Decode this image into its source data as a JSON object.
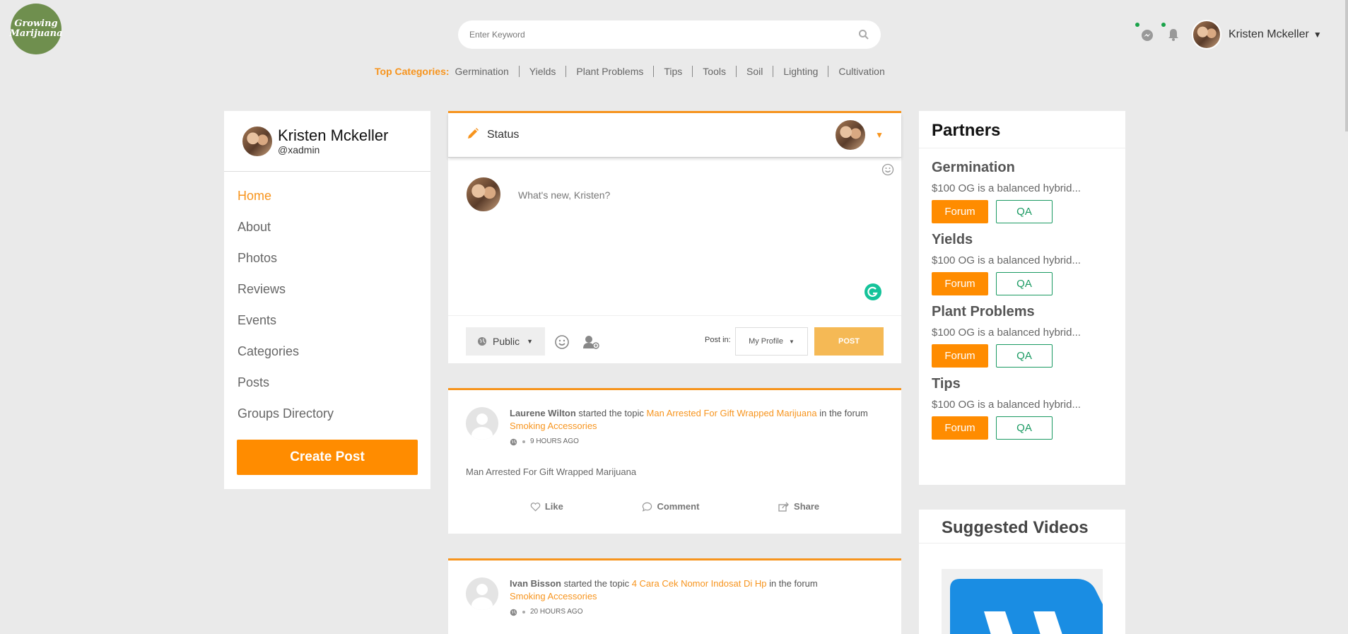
{
  "header": {
    "logo_line1": "Growing",
    "logo_line2": "Marijuana",
    "search_placeholder": "Enter Keyword",
    "top_categories_label": "Top Categories:",
    "top_categories": [
      "Germination",
      "Yields",
      "Plant Problems",
      "Tips",
      "Tools",
      "Soil",
      "Lighting",
      "Cultivation"
    ],
    "user_name": "Kristen Mckeller"
  },
  "profile": {
    "name": "Kristen Mckeller",
    "handle": "@xadmin"
  },
  "nav": {
    "items": [
      "Home",
      "About",
      "Photos",
      "Reviews",
      "Events",
      "Categories",
      "Posts",
      "Groups Directory"
    ],
    "create_post": "Create Post"
  },
  "composer": {
    "title": "Status",
    "placeholder": "What's new, Kristen?",
    "privacy": "Public",
    "post_in_label": "Post in:",
    "post_in_value": "My Profile",
    "post_button": "POST"
  },
  "feed": [
    {
      "author": "Laurene Wilton",
      "action": " started the topic ",
      "topic": "Man Arrested For Gift Wrapped Marijuana",
      "mid": " in the forum ",
      "forum": "Smoking Accessories",
      "time": "9 HOURS AGO",
      "body": "Man Arrested For Gift Wrapped Marijuana",
      "like": "Like",
      "comment": "Comment",
      "share": "Share"
    },
    {
      "author": "Ivan Bisson",
      "action": " started the topic ",
      "topic": "4 Cara Cek Nomor Indosat Di Hp",
      "mid": " in the forum ",
      "forum": "Smoking Accessories",
      "time": "20 HOURS AGO"
    }
  ],
  "partners": {
    "title": "Partners",
    "items": [
      {
        "name": "Germination",
        "desc": "$100 OG is a balanced hybrid...",
        "forum": "Forum",
        "qa": "QA"
      },
      {
        "name": "Yields",
        "desc": "$100 OG is a balanced hybrid...",
        "forum": "Forum",
        "qa": "QA"
      },
      {
        "name": "Plant Problems",
        "desc": "$100 OG is a balanced hybrid...",
        "forum": "Forum",
        "qa": "QA"
      },
      {
        "name": "Tips",
        "desc": "$100 OG is a balanced hybrid...",
        "forum": "Forum",
        "qa": "QA"
      }
    ]
  },
  "videos": {
    "title": "Suggested Videos"
  },
  "colors": {
    "accent": "#f7941d",
    "button_orange": "#ff8c00",
    "qa_green": "#1a9a62",
    "logo_green": "#6f8f4e"
  }
}
